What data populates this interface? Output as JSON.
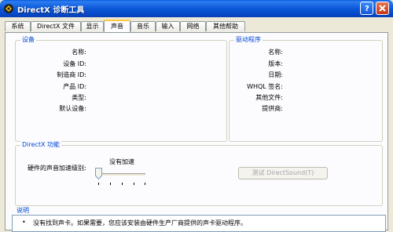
{
  "window": {
    "title": "DirectX 诊断工具"
  },
  "tabs": [
    {
      "label": "系统"
    },
    {
      "label": "DirectX 文件"
    },
    {
      "label": "显示"
    },
    {
      "label": "声音"
    },
    {
      "label": "音乐"
    },
    {
      "label": "输入"
    },
    {
      "label": "网络"
    },
    {
      "label": "其他帮助"
    }
  ],
  "active_tab": "声音",
  "device": {
    "title": "设备",
    "fields": [
      {
        "label": "名称:"
      },
      {
        "label": "设备 ID:"
      },
      {
        "label": "制造商 ID:"
      },
      {
        "label": "产品 ID:"
      },
      {
        "label": "类型:"
      },
      {
        "label": "默认设备:"
      }
    ]
  },
  "driver": {
    "title": "驱动程序",
    "fields": [
      {
        "label": "名称:"
      },
      {
        "label": "版本:"
      },
      {
        "label": "日期:"
      },
      {
        "label": "WHQL 签名:"
      },
      {
        "label": "其他文件:"
      },
      {
        "label": "提供商:"
      }
    ]
  },
  "directx_features": {
    "title": "DirectX 功能",
    "accel_label": "硬件的声音加速级别:",
    "accel_value": "没有加速",
    "test_button": "测试 DirectSound(T)"
  },
  "notes": {
    "title": "说明",
    "items": [
      "没有找到声卡。如果需要，您应该安装由硬件生产厂商提供的声卡驱动程序。"
    ]
  },
  "colors": {
    "titlebar": "#0b57d8",
    "group_title": "#0046d5",
    "window_bg": "#ece9d8",
    "active_tab_accent": "#ffc83c"
  }
}
